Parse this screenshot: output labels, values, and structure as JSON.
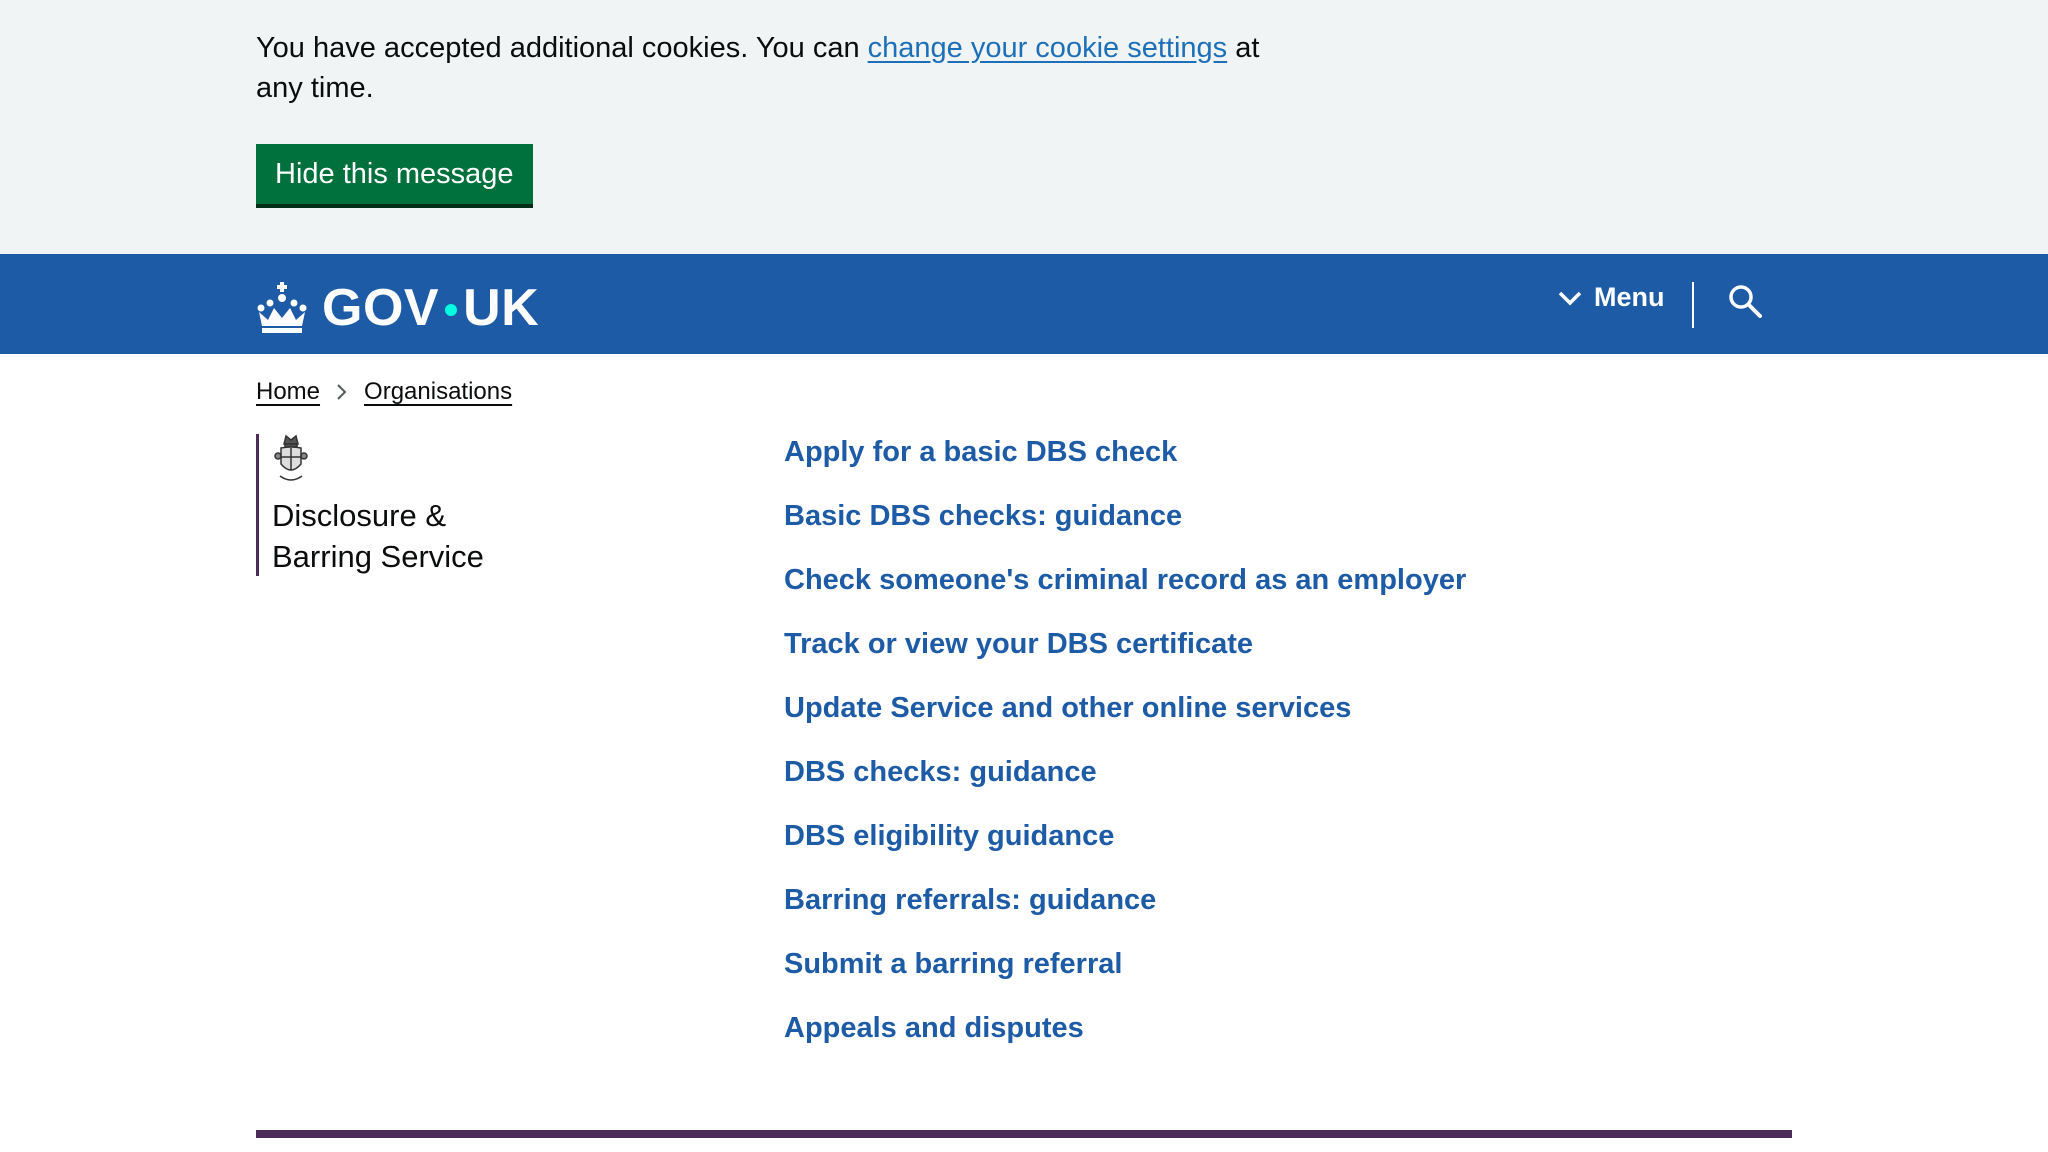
{
  "cookie_banner": {
    "text_before": "You have accepted additional cookies. You can ",
    "link_text": "change your cookie settings",
    "text_after": " at any time.",
    "hide_button": "Hide this message"
  },
  "header": {
    "logo_gov": "GOV",
    "logo_uk": "UK",
    "menu_label": "Menu",
    "crown_icon": "crown-icon",
    "search_icon": "search-icon"
  },
  "breadcrumb": [
    {
      "label": "Home"
    },
    {
      "label": "Organisations"
    }
  ],
  "organisation": {
    "name_line1": "Disclosure &",
    "name_line2": "Barring Service",
    "crest_icon": "royal-crest-icon"
  },
  "links": [
    "Apply for a basic DBS check",
    "Basic DBS checks: guidance",
    "Check someone's criminal record as an employer",
    "Track or view your DBS certificate",
    "Update Service and other online services",
    "DBS checks: guidance",
    "DBS eligibility guidance",
    "Barring referrals: guidance",
    "Submit a barring referral",
    "Appeals and disputes"
  ],
  "colors": {
    "banner_bg": "#f0f4f5",
    "header_bg": "#1d5ba6",
    "button_green": "#00703c",
    "link_blue": "#1d5ba6",
    "org_purple": "#4c2c5c",
    "logo_dot": "#00ffe0"
  }
}
